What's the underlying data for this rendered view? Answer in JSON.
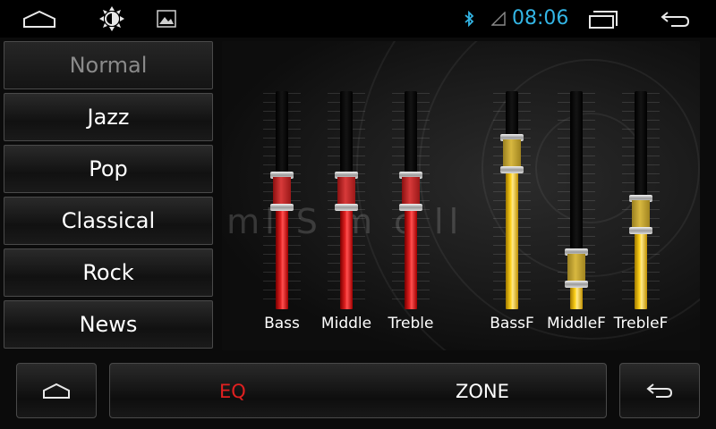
{
  "status_bar": {
    "time": "08:06",
    "time_color": "#33b5e5",
    "icons": [
      "home-outline-icon",
      "brightness-icon",
      "gallery-icon",
      "bluetooth-icon",
      "signal-icon",
      "recent-apps-icon",
      "back-arrow-icon"
    ]
  },
  "presets": [
    {
      "label": "Normal",
      "selected": true
    },
    {
      "label": "Jazz",
      "selected": false
    },
    {
      "label": "Pop",
      "selected": false
    },
    {
      "label": "Classical",
      "selected": false
    },
    {
      "label": "Rock",
      "selected": false
    },
    {
      "label": "News",
      "selected": false
    }
  ],
  "eq": {
    "watermark": "alaml    S    m     c ll",
    "sliders": [
      {
        "label": "Bass",
        "level": 0.55,
        "color": "red"
      },
      {
        "label": "Middle",
        "level": 0.55,
        "color": "red"
      },
      {
        "label": "Treble",
        "level": 0.55,
        "color": "red"
      },
      {
        "label": "BassF",
        "level": 0.76,
        "color": "yellow"
      },
      {
        "label": "MiddleF",
        "level": 0.12,
        "color": "yellow"
      },
      {
        "label": "TrebleF",
        "level": 0.42,
        "color": "yellow"
      }
    ]
  },
  "bottom_bar": {
    "tabs": [
      {
        "label": "EQ",
        "active": true
      },
      {
        "label": "ZONE",
        "active": false
      }
    ]
  },
  "colors": {
    "active_tab": "#e02020",
    "red_slider": "#e02020",
    "yellow_slider": "#ffd21a"
  }
}
